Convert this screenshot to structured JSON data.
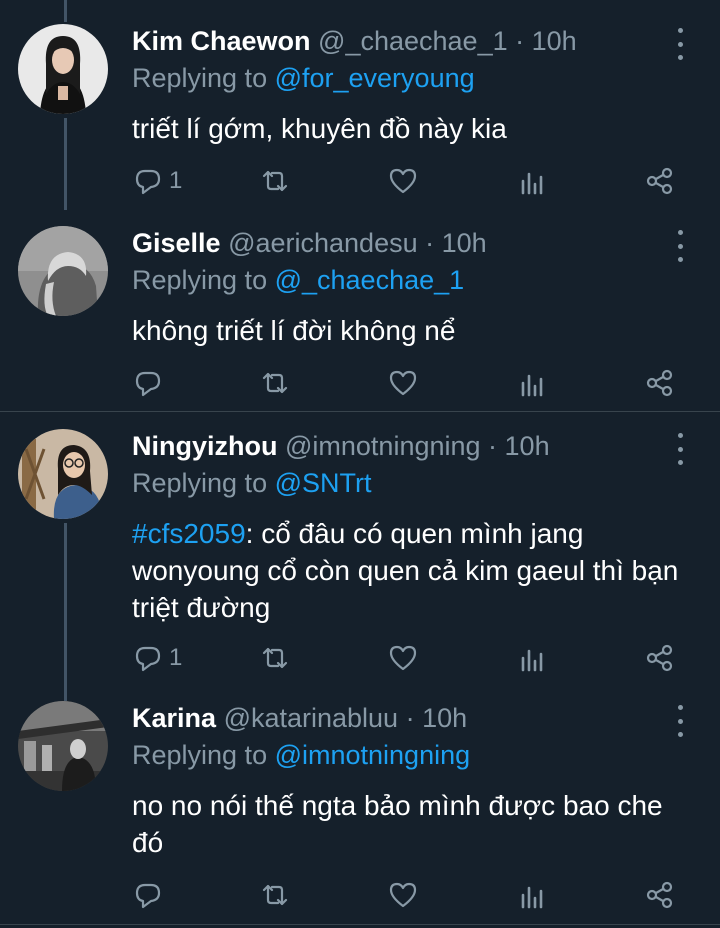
{
  "tweets": [
    {
      "name": "Kim Chaewon",
      "handle": "@_chaechae_1",
      "time": "10h",
      "replying_prefix": "Replying to ",
      "replying_to": "@for_everyoung",
      "hashtag": "",
      "text": "triết lí gớm, khuyên đồ này kia",
      "reply_count": "1",
      "avatar_icon": "avatar-photo"
    },
    {
      "name": "Giselle",
      "handle": "@aerichandesu",
      "time": "10h",
      "replying_prefix": "Replying to ",
      "replying_to": "@_chaechae_1",
      "hashtag": "",
      "text": "không triết lí đời không nể",
      "reply_count": "",
      "avatar_icon": "avatar-photo"
    },
    {
      "name": "Ningyizhou",
      "handle": "@imnotningning",
      "time": "10h",
      "replying_prefix": "Replying to ",
      "replying_to": "@SNTrt",
      "hashtag": "#cfs2059",
      "text": ": cổ đâu có quen mình jang wonyoung cổ còn quen cả kim gaeul thì bạn triệt đường",
      "reply_count": "1",
      "avatar_icon": "avatar-photo"
    },
    {
      "name": "Karina",
      "handle": "@katarinabluu",
      "time": "10h",
      "replying_prefix": "Replying to ",
      "replying_to": "@imnotningning",
      "hashtag": "",
      "text": "no no nói thế ngta bảo mình được bao che đó",
      "reply_count": "",
      "avatar_icon": "avatar-photo"
    }
  ],
  "separator": " · ",
  "icons": [
    "reply-icon",
    "retweet-icon",
    "like-icon",
    "analytics-icon",
    "share-icon",
    "more-icon"
  ],
  "colors": {
    "background": "#15202b",
    "accent": "#1da1f2",
    "muted": "#8899a6",
    "divider": "#38444d"
  }
}
